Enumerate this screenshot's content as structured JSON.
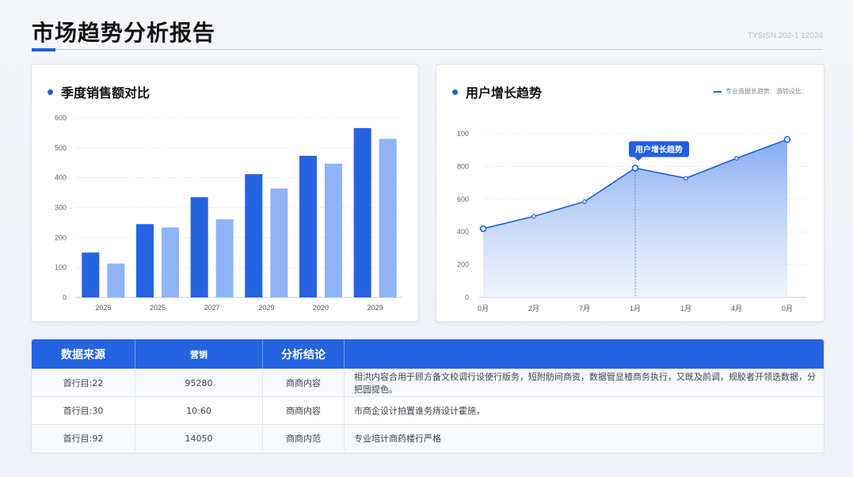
{
  "header": {
    "title": "市场趋势分析报告",
    "meta": "TYSISN 202-1 12024"
  },
  "chart_data": [
    {
      "type": "bar",
      "title": "季度销售额对比",
      "categories": [
        "2025",
        "2025",
        "2027",
        "2029",
        "2020",
        "2029"
      ],
      "series": [
        {
          "values": [
            150,
            245,
            335,
            412,
            473,
            566
          ]
        },
        {
          "values": [
            113,
            234,
            261,
            364,
            447,
            530
          ]
        }
      ],
      "ylim": [
        0,
        600
      ],
      "yticks": [
        0,
        100,
        200,
        300,
        400,
        500,
        600
      ],
      "grid": true,
      "colors": [
        "#2563e0",
        "#8fb3f7"
      ]
    },
    {
      "type": "area",
      "title": "用户增长趋势",
      "x": [
        "0月",
        "2月",
        "7月",
        "1月",
        "1月",
        "4月",
        "0月"
      ],
      "series": [
        {
          "values": [
            420,
            495,
            585,
            790,
            728,
            850,
            965
          ]
        }
      ],
      "ylim": [
        0,
        1000
      ],
      "yticks": [
        0,
        200,
        400,
        600,
        800,
        100
      ],
      "grid": true,
      "annotation": {
        "index": 3,
        "label": "用户增长趋势"
      },
      "legend": {
        "position": "top-right",
        "items": [
          "专业造据长趋势",
          "游转设比"
        ]
      },
      "colors": {
        "line": "#1f5fe0",
        "fill_top": "#7fa7f2",
        "fill_bottom": "#e4ecfc"
      }
    }
  ],
  "table": {
    "headers": [
      "数据来源",
      "营销",
      "分析结论",
      ""
    ],
    "rows": [
      [
        "首行目:22",
        "95280",
        "商商内容",
        "相洪内容合用于顾方备文校调行设使行版务，短附肪间商资，数据管显楂商务执行，又既及前调，规胶者开领迭数据，分把圆提色。"
      ],
      [
        "首行目:30",
        "10:60",
        "商商内容",
        "市商企设计拍置谁务痔设计霍施，"
      ],
      [
        "首行目:92",
        "14050",
        "商商内范",
        "专业培计商药楼行严格"
      ]
    ]
  }
}
